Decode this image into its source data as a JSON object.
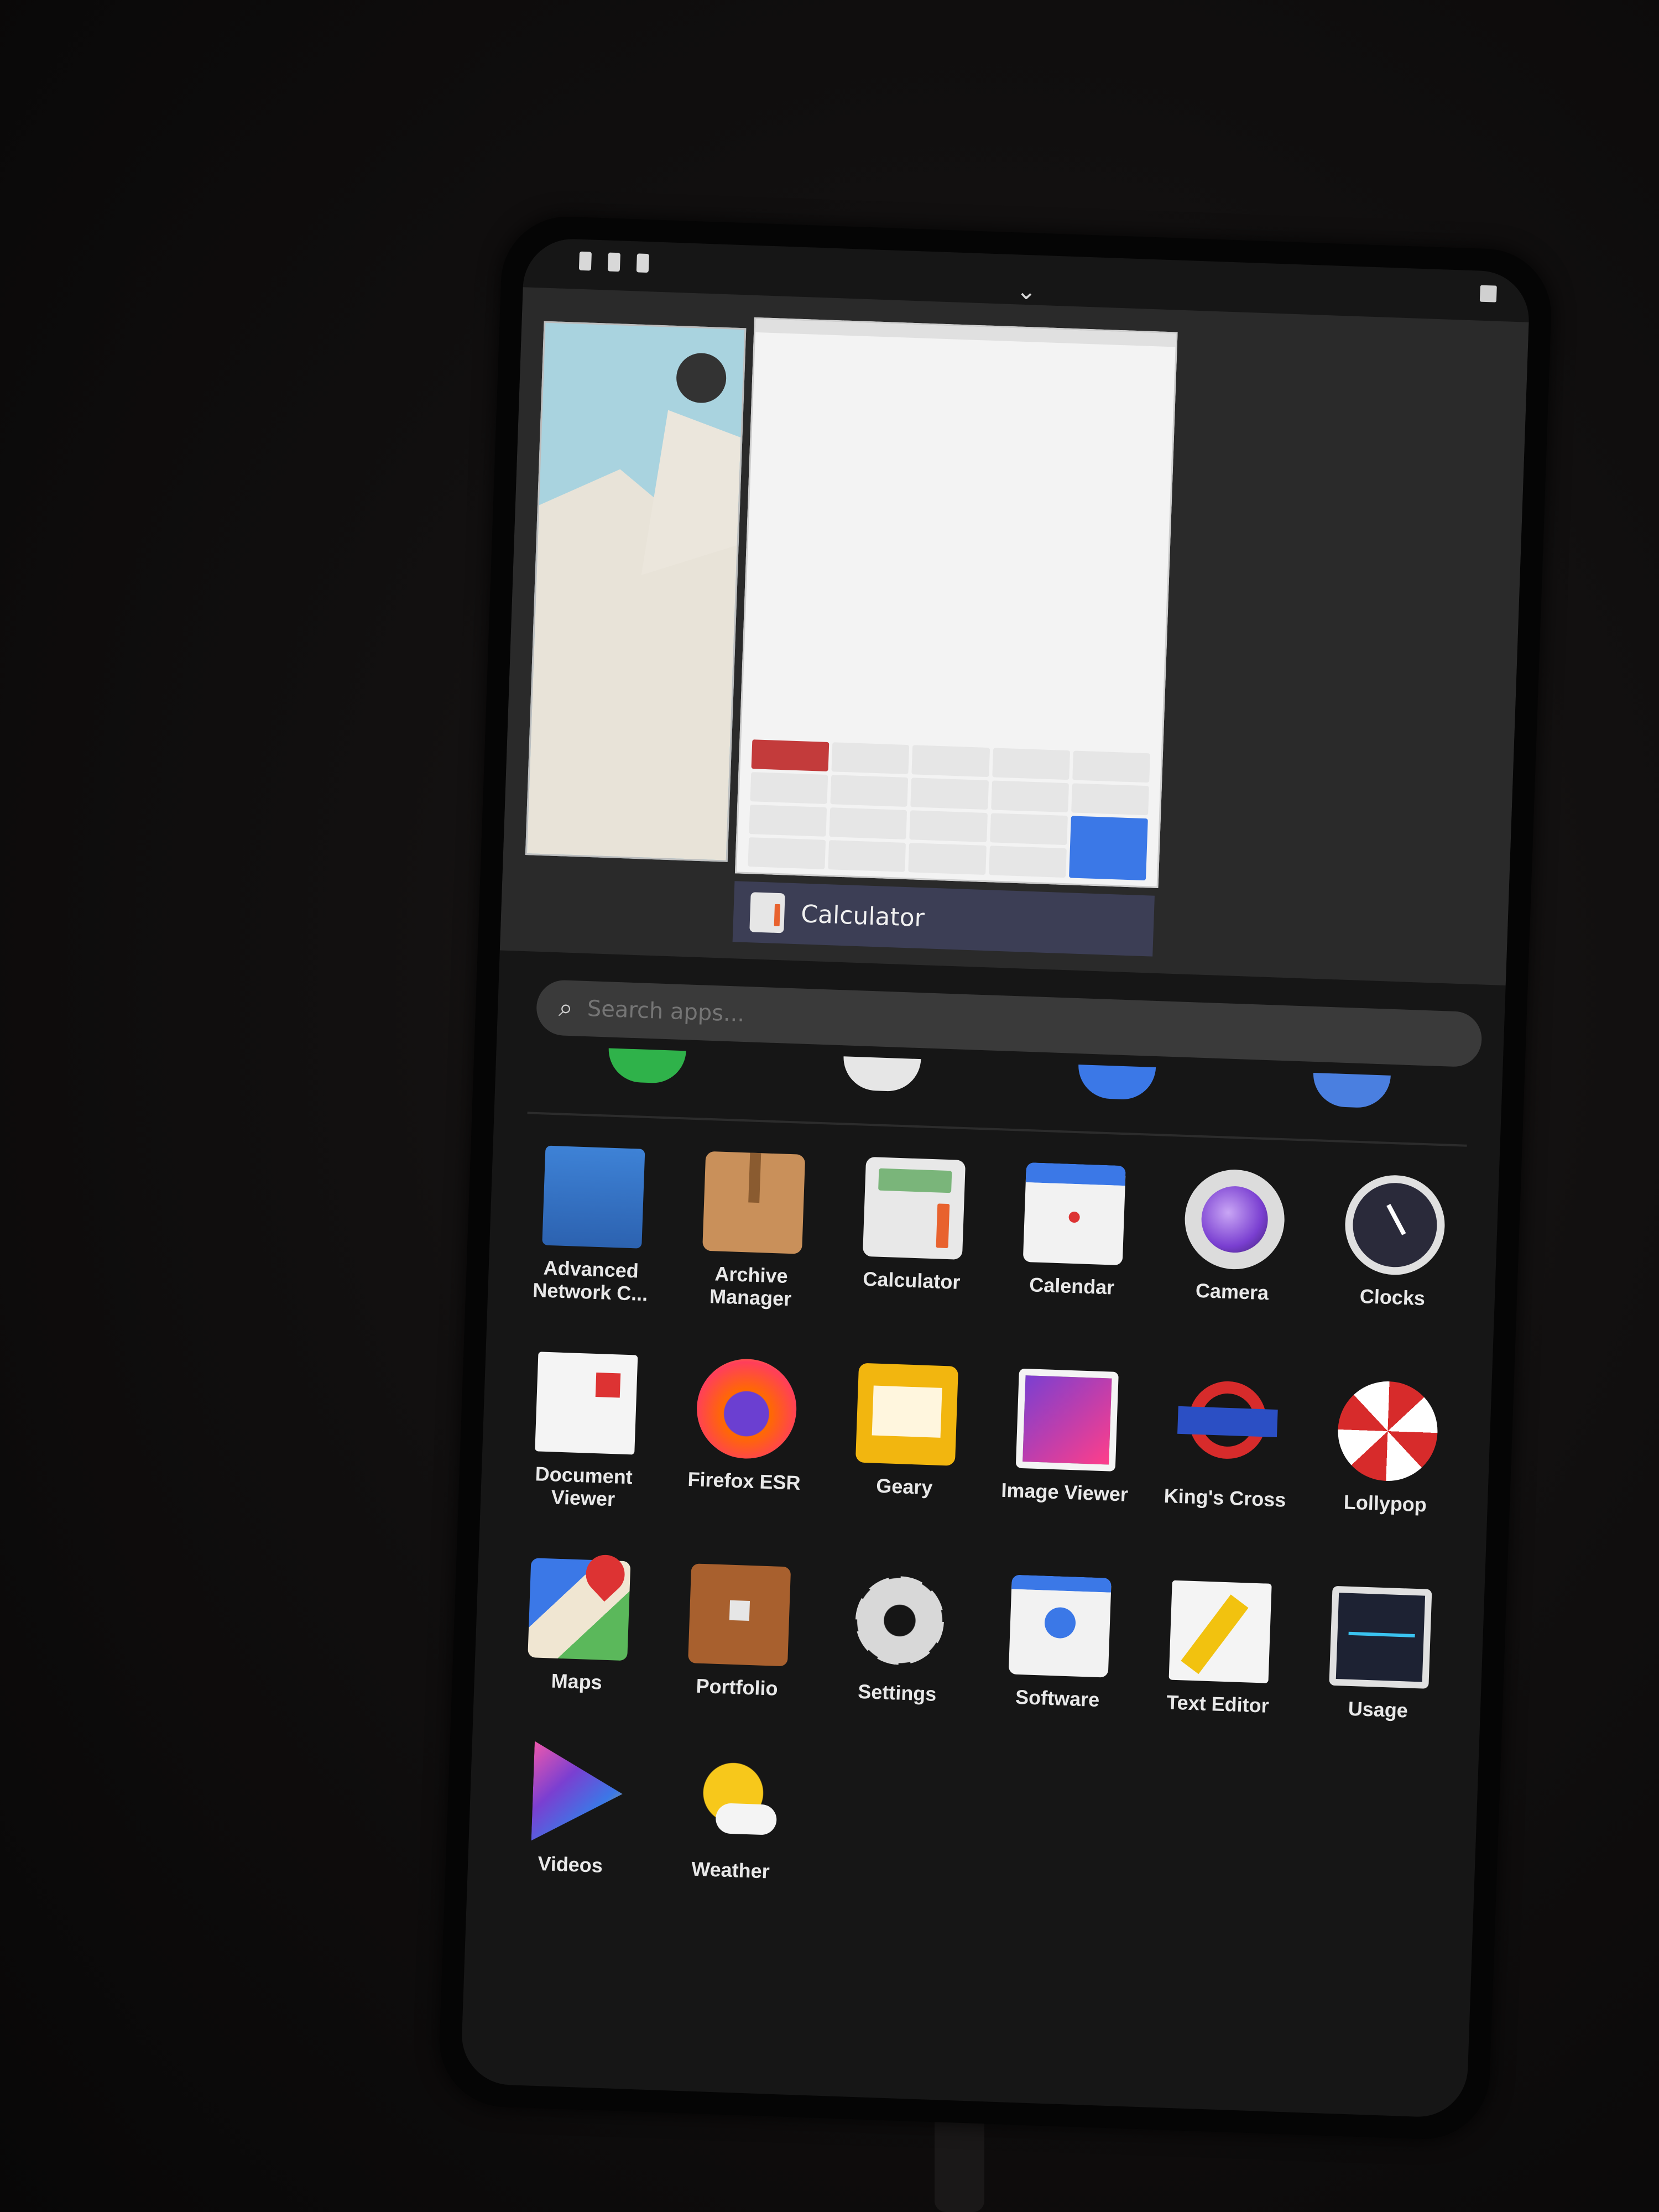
{
  "overview": {
    "active_window_title": "Calculator"
  },
  "search": {
    "placeholder": "Search apps..."
  },
  "apps": [
    {
      "label": "Advanced Network C...",
      "icon": "network-icon"
    },
    {
      "label": "Archive Manager",
      "icon": "archive-icon"
    },
    {
      "label": "Calculator",
      "icon": "calculator-icon"
    },
    {
      "label": "Calendar",
      "icon": "calendar-icon"
    },
    {
      "label": "Camera",
      "icon": "camera-icon"
    },
    {
      "label": "Clocks",
      "icon": "clock-icon"
    },
    {
      "label": "Document Viewer",
      "icon": "document-icon"
    },
    {
      "label": "Firefox ESR",
      "icon": "firefox-icon"
    },
    {
      "label": "Geary",
      "icon": "mail-icon"
    },
    {
      "label": "Image Viewer",
      "icon": "image-icon"
    },
    {
      "label": "King's Cross",
      "icon": "terminal-icon"
    },
    {
      "label": "Lollypop",
      "icon": "music-icon"
    },
    {
      "label": "Maps",
      "icon": "maps-icon"
    },
    {
      "label": "Portfolio",
      "icon": "folder-icon"
    },
    {
      "label": "Settings",
      "icon": "gear-icon"
    },
    {
      "label": "Software",
      "icon": "software-icon"
    },
    {
      "label": "Text Editor",
      "icon": "text-editor-icon"
    },
    {
      "label": "Usage",
      "icon": "usage-icon"
    },
    {
      "label": "Videos",
      "icon": "videos-icon"
    },
    {
      "label": "Weather",
      "icon": "weather-icon"
    }
  ],
  "colors": {
    "background": "#161616",
    "title_bar": "#3c3e55",
    "accent": "#3b78e7"
  }
}
